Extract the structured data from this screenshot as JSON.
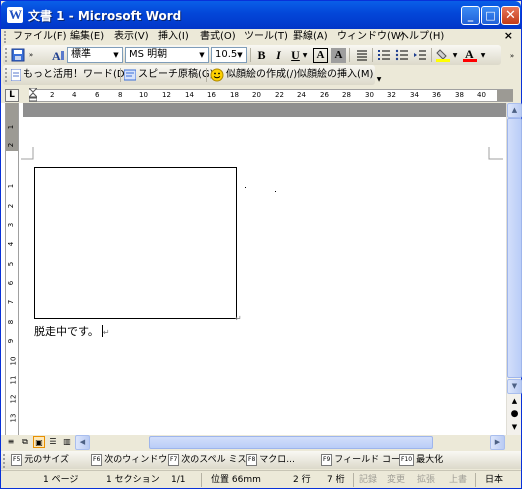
{
  "window": {
    "title": "文書 1 - Microsoft Word",
    "controls": {
      "minimize": "_",
      "maximize": "□",
      "close": "✕"
    }
  },
  "menu": {
    "items": [
      "ファイル(F)",
      "編集(E)",
      "表示(V)",
      "挿入(I)",
      "書式(O)",
      "ツール(T)",
      "罫線(A)",
      "ウィンドウ(W)",
      "ヘルプ(H)"
    ],
    "close": "×"
  },
  "format_toolbar": {
    "style": "標準",
    "font": "MS 明朝",
    "size": "10.5",
    "bold": "B",
    "italic": "I",
    "underline": "U",
    "char_border": "A",
    "char_shading": "A",
    "font_color_letter": "A",
    "highlight_color": "#FFFF00",
    "font_color": "#FF0000"
  },
  "extra_toolbar": {
    "items": [
      "もっと活用！ワード(D)",
      "スピーチ原稿(G)",
      "似顔絵の作成(/)",
      "似顔絵の挿入(M)"
    ]
  },
  "ruler": {
    "corner": "L",
    "h_ticks": [
      "2",
      "4",
      "6",
      "8",
      "10",
      "12",
      "14",
      "16",
      "18",
      "20",
      "22",
      "24",
      "26",
      "28",
      "30",
      "32",
      "34",
      "36",
      "38",
      "40"
    ],
    "v_ticks": [
      "1",
      "2",
      "1",
      "2",
      "3",
      "4",
      "5",
      "6",
      "7",
      "8",
      "9",
      "10",
      "11",
      "12",
      "13"
    ]
  },
  "document": {
    "text": "脱走中です。",
    "para_mark": "↵"
  },
  "function_keys": [
    {
      "key": "F5",
      "label": "元のサイズ"
    },
    {
      "key": "F6",
      "label": "次のウィンドウ"
    },
    {
      "key": "F7",
      "label": "次のスペル ミス"
    },
    {
      "key": "F8",
      "label": "マクロ..."
    },
    {
      "key": "F9",
      "label": "フィールド コー..."
    },
    {
      "key": "F10",
      "label": "最大化"
    }
  ],
  "status": {
    "page": "1 ページ",
    "section": "1 セクション",
    "pages": "1/1",
    "position": "位置  66mm",
    "line": "2 行",
    "column": "7 桁",
    "rec": "記録",
    "trk": "変更",
    "ext": "拡張",
    "ovr": "上書",
    "language": "日本"
  }
}
